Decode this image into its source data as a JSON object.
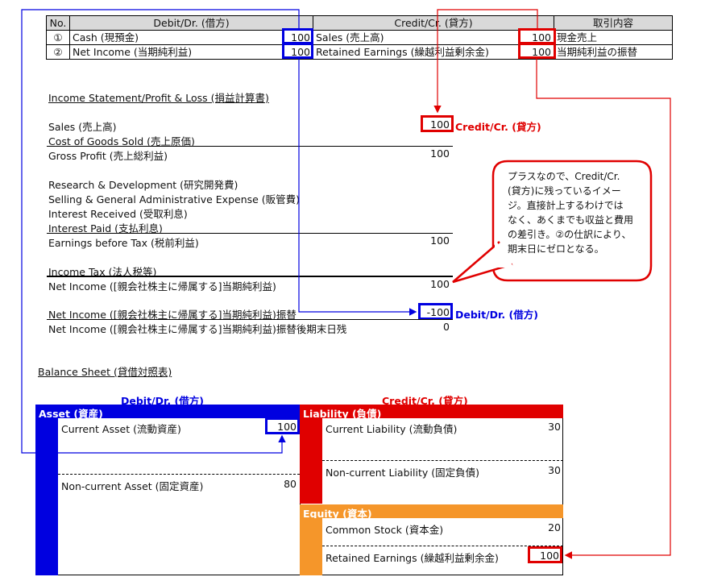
{
  "journal": {
    "headers": [
      "No.",
      "Debit/Dr. (借方)",
      "",
      "Credit/Cr. (貸方)",
      "",
      "取引内容"
    ],
    "rows": [
      {
        "no": "①",
        "debit": "Cash (現預金)",
        "debit_amt": "100",
        "credit": "Sales (売上高)",
        "credit_amt": "100",
        "desc": "現金売上"
      },
      {
        "no": "②",
        "debit": "Net Income (当期純利益)",
        "debit_amt": "100",
        "credit": "Retained Earnings (繰越利益剰余金)",
        "credit_amt": "100",
        "desc": "当期純利益の振替"
      }
    ]
  },
  "income_statement": {
    "title": "Income Statement/Profit & Loss (損益計算書)",
    "sales_label": "Sales (売上高)",
    "sales_value": "100",
    "sales_side": "Credit/Cr. (貸方)",
    "cogs_label": "Cost of Goods Sold (売上原価)",
    "gross_label": "Gross Profit (売上総利益)",
    "gross_value": "100",
    "rd_label": "Research & Development (研究開発費)",
    "sga_label": "Selling & General Administrative Expense (販管費)",
    "int_recv_label": "Interest Received (受取利息)",
    "int_paid_label": "Interest Paid (支払利息)",
    "ebt_label": "Earnings before Tax (税前利益)",
    "ebt_value": "100",
    "tax_label": "Income Tax (法人税等)",
    "ni_label": "Net Income ([親会社株主に帰属する]当期純利益)",
    "ni_value": "100",
    "ni_transfer_label": "Net Income ([親会社株主に帰属する]当期純利益)振替",
    "ni_transfer_value": "-100",
    "ni_transfer_side": "Debit/Dr. (借方)",
    "ni_end_label": "Net Income ([親会社株主に帰属する]当期純利益)振替後期末日残",
    "ni_end_value": "0"
  },
  "callout": {
    "text": "プラスなので、Credit/Cr.\n(貸方)に残っているイメー\nジ。直接計上するわけでは\nなく、あくまでも収益と費用\nの差引き。②の仕訳により、\n期末日にゼロとなる。"
  },
  "balance_sheet": {
    "title": "Balance Sheet (貸借対照表)",
    "debit_header": "Debit/Dr. (借方)",
    "credit_header": "Credit/Cr. (貸方)",
    "asset_label": "Asset (資産)",
    "current_asset_label": "Current Asset (流動資産)",
    "current_asset_value": "100",
    "noncurrent_asset_label": "Non-current Asset (固定資産)",
    "noncurrent_asset_value": "80",
    "liability_label": "Liability (負債)",
    "current_liability_label": "Current Liability (流動負債)",
    "current_liability_value": "30",
    "noncurrent_liability_label": "Non-current Liability (固定負債)",
    "noncurrent_liability_value": "30",
    "equity_label": "Equity (資本)",
    "common_stock_label": "Common Stock (資本金)",
    "common_stock_value": "20",
    "retained_label": "Retained Earnings (繰越利益剰余金)",
    "retained_value": "100"
  },
  "colors": {
    "blue": "#0000e0",
    "red": "#e00000",
    "orange": "#f5962a",
    "header_gray": "#d9d9d9"
  }
}
